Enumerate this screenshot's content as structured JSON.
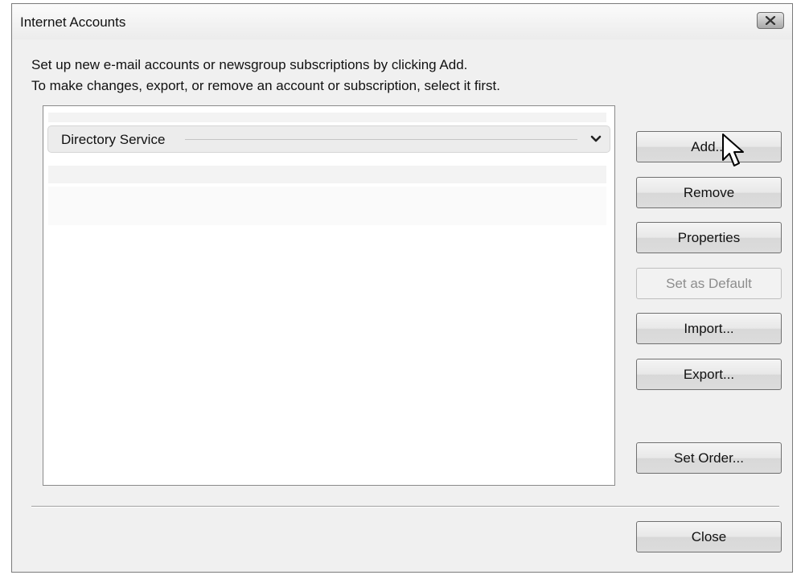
{
  "window": {
    "title": "Internet Accounts"
  },
  "instructions": {
    "line1": "Set up new e-mail accounts or newsgroup subscriptions by clicking Add.",
    "line2": "To make changes, export, or remove an account or subscription, select it first."
  },
  "account_list": {
    "group_header": "Directory Service",
    "rows": []
  },
  "buttons": {
    "add": "Add...",
    "remove": "Remove",
    "properties": "Properties",
    "set_default": "Set as Default",
    "import": "Import...",
    "export": "Export...",
    "set_order": "Set Order...",
    "close": "Close"
  },
  "icons": {
    "close": "close-icon",
    "chevron": "chevron-down-icon",
    "cursor": "mouse-pointer-icon"
  },
  "colors": {
    "dialog_background": "#f0f0f0",
    "disabled_text": "#8d8d8d"
  }
}
